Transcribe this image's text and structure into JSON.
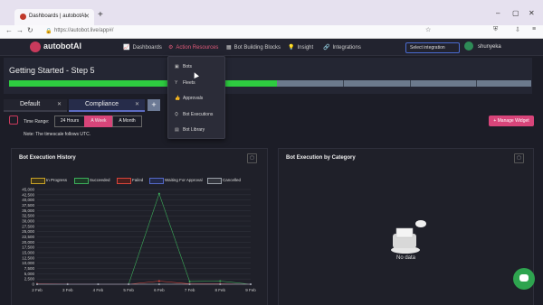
{
  "browser": {
    "tab_title": "Dashboards | autobotAI",
    "new_tab": "+",
    "url": "https://autobot.live/app#/",
    "win_min": "–",
    "win_max": "▢",
    "win_close": "✕",
    "nav_back": "←",
    "nav_fwd": "→",
    "nav_reload": "↻"
  },
  "app": {
    "brand": "autobotAI",
    "menu": [
      {
        "label": "Dashboards",
        "icon": "📈"
      },
      {
        "label": "Action Resources",
        "icon": "⚙"
      },
      {
        "label": "Bot Building Blocks",
        "icon": "▦"
      },
      {
        "label": "Insight",
        "icon": "💡"
      },
      {
        "label": "Integrations",
        "icon": "🔗"
      }
    ],
    "select_integration": "Select integration",
    "user": "shunyeka"
  },
  "getting_started": {
    "title": "Getting Started - Step 5",
    "green_color": "#2ecc40",
    "gray_color": "#6c7a8d"
  },
  "dashboard_tabs": [
    {
      "label": "Default",
      "close": "✕"
    },
    {
      "label": "Compliance",
      "close": "✕"
    }
  ],
  "add_tab": "+",
  "time_range": {
    "label": "Time Range:",
    "options": [
      "24 Hours",
      "A Week",
      "A Month"
    ],
    "selected": "A Week",
    "note": "Note: The timescale follows UTC."
  },
  "manage_widget": "+ Manage Widget",
  "dropdown": {
    "items": [
      {
        "label": "Bots",
        "icon": "▣"
      },
      {
        "label": "Fleets",
        "icon": "Y"
      },
      {
        "label": "Approvals",
        "icon": "👍"
      },
      {
        "label": "Bot Executions",
        "icon": "⛭"
      },
      {
        "label": "Bot Library",
        "icon": "▤"
      }
    ]
  },
  "panels": {
    "left_title": "Bot Execution History",
    "right_title": "Bot Execution by Category",
    "no_data": "No data"
  },
  "chart_data": {
    "type": "line",
    "title": "Bot Execution History",
    "categories": [
      "2 Feb",
      "3 Feb",
      "4 Feb",
      "5 Feb",
      "6 Feb",
      "7 Feb",
      "8 Feb",
      "9 Feb"
    ],
    "ylim": [
      0,
      45000
    ],
    "yticks": [
      "0",
      "2,500",
      "5,000",
      "7,500",
      "10,000",
      "12,500",
      "15,000",
      "17,500",
      "20,000",
      "22,500",
      "25,000",
      "27,500",
      "30,000",
      "32,500",
      "35,000",
      "37,500",
      "40,000",
      "42,500",
      "45,000"
    ],
    "legend_position": "top",
    "series": [
      {
        "name": "In Progress",
        "color": "#c9a227",
        "values": [
          0,
          0,
          0,
          0,
          0,
          0,
          0,
          0
        ]
      },
      {
        "name": "Succeeded",
        "color": "#3cae5a",
        "values": [
          0,
          0,
          0,
          0,
          43000,
          1300,
          1500,
          0
        ]
      },
      {
        "name": "Failed",
        "color": "#d9443a",
        "values": [
          200,
          100,
          0,
          0,
          1500,
          200,
          200,
          0
        ]
      },
      {
        "name": "Waiting For Approval",
        "color": "#5468c8",
        "values": [
          0,
          0,
          0,
          0,
          0,
          0,
          0,
          0
        ]
      },
      {
        "name": "Cancelled",
        "color": "#9aa0a8",
        "values": [
          0,
          0,
          0,
          0,
          0,
          0,
          0,
          0
        ]
      }
    ]
  }
}
